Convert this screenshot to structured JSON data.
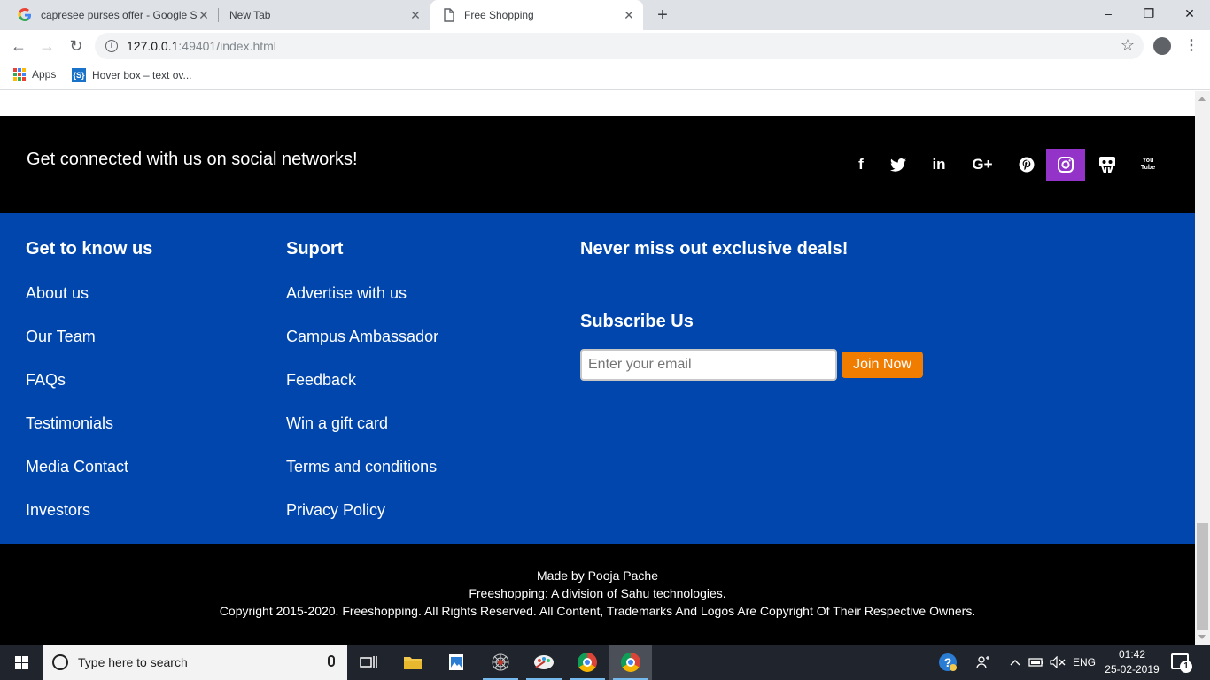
{
  "browser": {
    "tabs": [
      {
        "title": "capresee purses offer - Google S",
        "icon": "google-icon",
        "active": false
      },
      {
        "title": "New Tab",
        "icon": "",
        "active": false
      },
      {
        "title": "Free Shopping",
        "icon": "page-icon",
        "active": true
      }
    ],
    "new_tab_symbol": "+",
    "window_controls": {
      "minimize": "–",
      "maximize": "❐",
      "close": "✕"
    },
    "url": {
      "host": "127.0.0.1",
      "rest": ":49401/index.html"
    },
    "bookmarks": [
      {
        "label": "Apps",
        "icon": "apps-grid-icon"
      },
      {
        "label": "Hover box – text ov...",
        "icon": "hoverbox-site-icon"
      }
    ]
  },
  "page": {
    "social": {
      "text": "Get connected with us on social networks!",
      "icons": [
        "facebook-icon",
        "twitter-icon",
        "linkedin-icon",
        "google-plus-icon",
        "pinterest-icon",
        "instagram-icon",
        "slideshare-icon",
        "youtube-icon"
      ],
      "highlighted": "instagram-icon",
      "highlight_color": "#9333c8",
      "glyphs": {
        "facebook": "f",
        "twitter": "🐦",
        "linkedin": "in",
        "google_plus": "G+",
        "pinterest": "P",
        "youtube": "You Tube"
      }
    },
    "columns": [
      {
        "title": "Get to know us",
        "links": [
          "About us",
          "Our Team",
          "FAQs",
          "Testimonials",
          "Media Contact",
          "Investors"
        ]
      },
      {
        "title": "Suport",
        "links": [
          "Advertise with us",
          "Campus Ambassador",
          "Feedback",
          "Win a gift card",
          "Terms and conditions",
          "Privacy Policy"
        ]
      }
    ],
    "deals": {
      "title": "Never miss out exclusive deals!",
      "subscribe_title": "Subscribe Us",
      "email_placeholder": "Enter your email",
      "button_label": "Join Now"
    },
    "footer": {
      "made_by": "Made by Pooja Pache",
      "division": "Freeshopping: A division of Sahu technologies.",
      "copyright": "Copyright 2015-2020. Freeshopping. All Rights Reserved. All Content, Trademarks And Logos Are Copyright Of Their Respective Owners."
    },
    "colors": {
      "blue_bg": "#0046ad",
      "black_bg": "#000000",
      "button_orange": "#f07c00"
    }
  },
  "taskbar": {
    "search_placeholder": "Type here to search",
    "pinned": [
      "task-view-icon",
      "file-explorer-icon",
      "photos-icon",
      "spider-app-icon",
      "paint-app-icon",
      "chrome-icon",
      "chrome-active-icon"
    ],
    "tray": {
      "language": "ENG",
      "time": "01:42",
      "date": "25-02-2019",
      "notifications": "1"
    }
  }
}
